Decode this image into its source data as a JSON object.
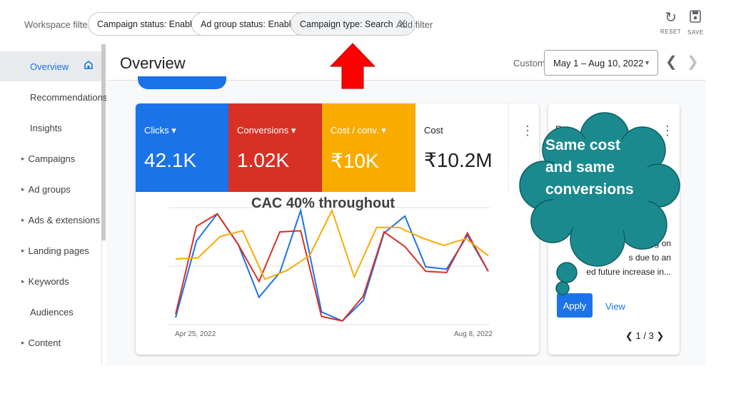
{
  "filter_bar": {
    "workspace_label": "Workspace filter",
    "chips": [
      {
        "label": "Campaign status: Enabled"
      },
      {
        "label": "Ad group status: Enabled"
      },
      {
        "label": "Campaign type: Search",
        "close": "X"
      }
    ],
    "add_filter": "Add filter",
    "reset_label": "RESET",
    "save_label": "SAVE"
  },
  "sidebar": {
    "items": [
      {
        "label": "Overview",
        "selected": true
      },
      {
        "label": "Recommendations"
      },
      {
        "label": "Insights"
      },
      {
        "label": "Campaigns",
        "expandable": true
      },
      {
        "label": "Ad groups",
        "expandable": true
      },
      {
        "label": "Ads & extensions",
        "expandable": true
      },
      {
        "label": "Landing pages",
        "expandable": true
      },
      {
        "label": "Keywords",
        "expandable": true
      },
      {
        "label": "Audiences"
      },
      {
        "label": "Content",
        "expandable": true
      }
    ]
  },
  "header": {
    "title": "Overview",
    "custom_label": "Custom",
    "date_range": "May 1 – Aug 10, 2022"
  },
  "metrics": [
    {
      "label": "Clicks",
      "value": "42.1K",
      "color": "#1a73e8"
    },
    {
      "label": "Conversions",
      "value": "1.02K",
      "color": "#d93025"
    },
    {
      "label": "Cost / conv.",
      "value": "₹10K",
      "color": "#f9ab00"
    },
    {
      "label": "Cost",
      "value": "₹10.2M",
      "color": "#ffffff"
    }
  ],
  "chart_data": {
    "type": "line",
    "x_start_label": "Apr 25, 2022",
    "x_end_label": "Aug 8, 2022",
    "grid": true,
    "series": [
      {
        "color": "#1a73e8",
        "values": [
          5,
          73,
          97,
          70,
          23,
          45,
          100,
          10,
          2,
          20,
          80,
          95,
          50,
          48,
          78,
          46
        ]
      },
      {
        "color": "#d93025",
        "values": [
          8,
          86,
          97,
          70,
          37,
          81,
          82,
          6,
          2,
          24,
          81,
          68,
          46,
          45,
          80,
          46
        ]
      },
      {
        "color": "#f9ab00",
        "values": [
          57,
          58,
          77,
          82,
          39,
          47,
          60,
          100,
          41,
          85,
          85,
          76,
          69,
          75,
          60
        ]
      }
    ]
  },
  "recommendation": {
    "title": "Re",
    "desc_lines": [
      "g on",
      "s due to an",
      "ed future increase in..."
    ],
    "apply_label": "Apply",
    "view_label": "View",
    "pager": "1 / 3"
  },
  "annotations": {
    "chart_note": "CAC 40% throughout",
    "bubble_lines": [
      "Same cost",
      "and same",
      "conversions"
    ],
    "arrow_color": "#ff0000",
    "bubble_color": "#1a8a8f"
  }
}
